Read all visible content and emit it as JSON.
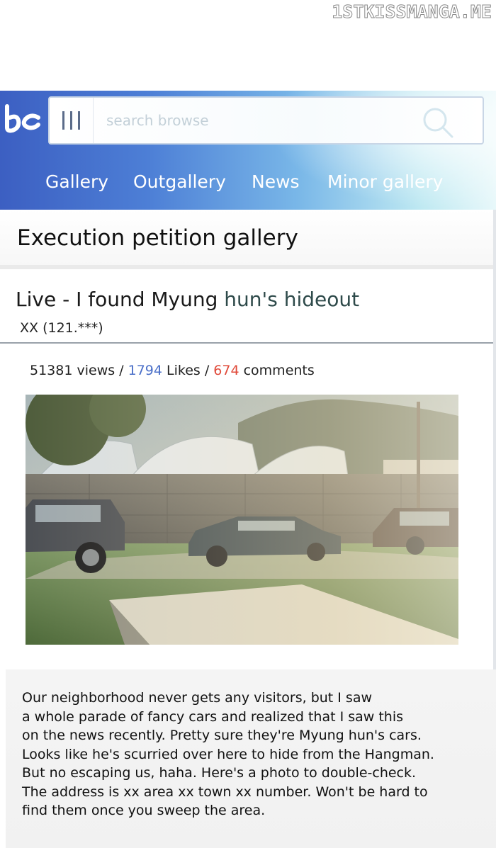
{
  "watermark": "1STKISSMANGA.ME",
  "header": {
    "logo_icon": "bc-logo-icon",
    "menu_icon": "menu-bars-icon",
    "search_placeholder": "search browse",
    "search_icon": "search-icon"
  },
  "nav": {
    "items": [
      {
        "label": "Gallery"
      },
      {
        "label": "Outgallery"
      },
      {
        "label": "News"
      },
      {
        "label": "Minor gallery"
      }
    ]
  },
  "gallery": {
    "title": "Execution petition gallery"
  },
  "post": {
    "title_main": "Live - I found Myung ",
    "title_tail": "hun's hideout",
    "author": "XX (121.***)",
    "views": "51381",
    "views_label": " views / ",
    "likes": "1794",
    "likes_label": " Likes / ",
    "comments": "674",
    "comments_label": " comments",
    "photo_icon": "parking-lot-photo",
    "body_lines": [
      "Our neighborhood never gets any visitors, but I saw",
      "a whole parade of fancy cars and realized that I saw this",
      "on the news recently. Pretty sure they're Myung hun's cars.",
      "Looks like he's scurried over here to hide from the Hangman.",
      "But no escaping us, haha. Here's a photo to double-check.",
      "The address is xx area xx town xx number. Won't be hard to",
      "find them once you sweep the area."
    ]
  },
  "colors": {
    "likes": "#4a6fc8",
    "comments": "#e04a3a",
    "nav_bg_start": "#3c5fc2",
    "nav_bg_end": "#e8f8fa"
  }
}
